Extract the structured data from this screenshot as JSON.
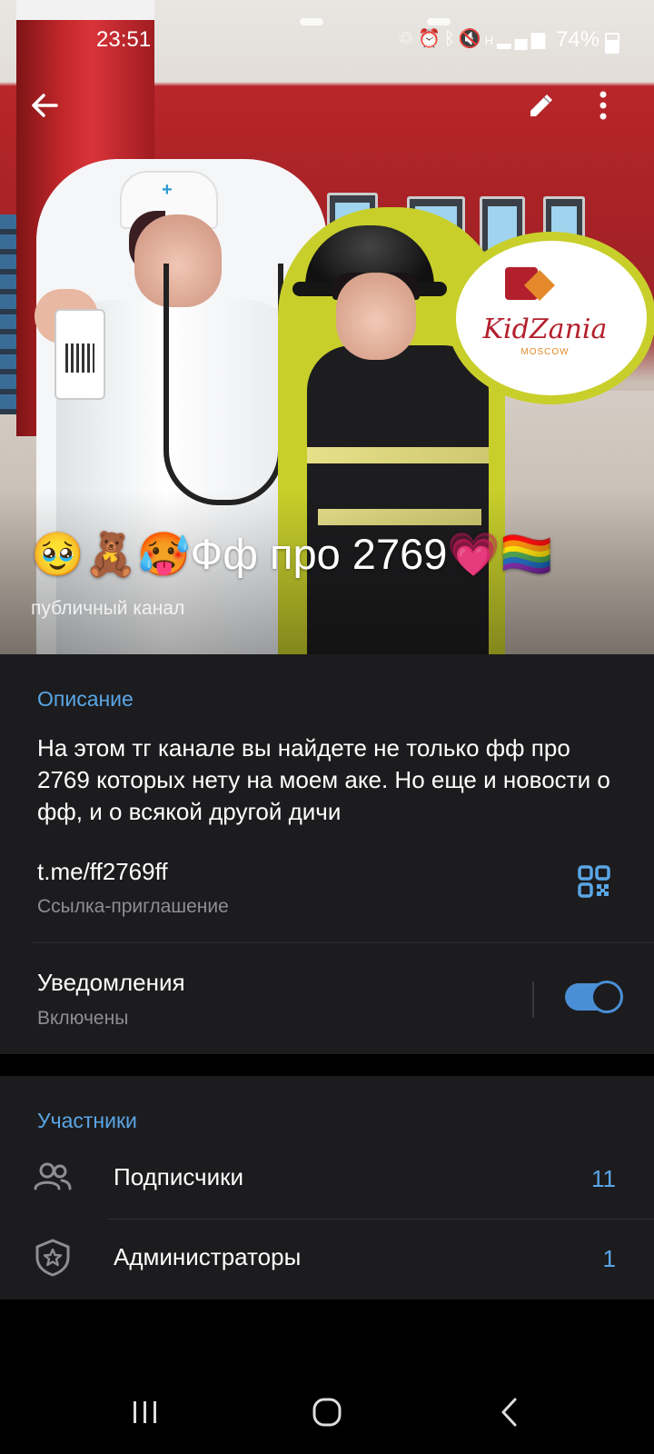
{
  "status_bar": {
    "time": "23:51",
    "battery": "74%",
    "icons": [
      "recycle-icon",
      "alarm-icon",
      "bluetooth-icon",
      "mute-icon",
      "network-h-icon",
      "signal-icon"
    ]
  },
  "header": {
    "title": "🥹🧸🥵Фф про 2769💗🏳️‍🌈",
    "subtitle": "публичный канал",
    "photo_sign_text": "KidZania",
    "photo_sign_sub": "MOSCOW"
  },
  "info": {
    "description_label": "Описание",
    "description": "На этом тг канале вы найдете не только фф про 2769 которых нету на моем аке. Но еще и новости о фф, и о всякой другой дичи",
    "link": "t.me/ff2769ff",
    "link_caption": "Ссылка-приглашение",
    "notifications_label": "Уведомления",
    "notifications_state": "Включены",
    "notifications_on": true
  },
  "members": {
    "label": "Участники",
    "rows": [
      {
        "label": "Подписчики",
        "count": "11",
        "icon": "people-icon"
      },
      {
        "label": "Администраторы",
        "count": "1",
        "icon": "shield-star-icon"
      }
    ]
  },
  "colors": {
    "accent": "#5aa6e6",
    "card": "#1c1c1e",
    "background": "#000000",
    "secondary_text": "#8e8e93",
    "toggle": "#4a8fd6"
  }
}
